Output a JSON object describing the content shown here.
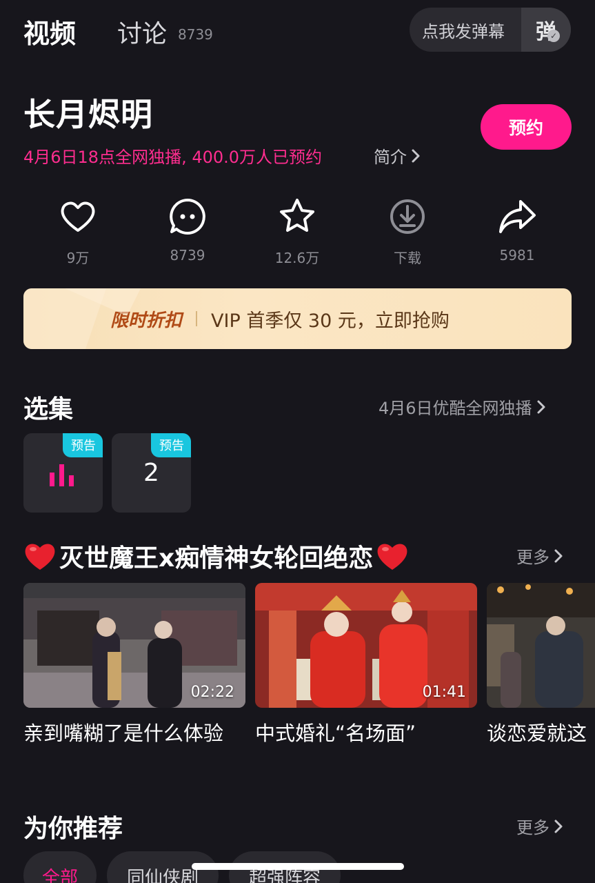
{
  "tabs": {
    "video": "视频",
    "discuss": "讨论",
    "discuss_count": "8739"
  },
  "danmu": {
    "placeholder": "点我发弹幕",
    "toggle_label": "弹"
  },
  "show": {
    "title": "长月烬明",
    "premiere_info": "4月6日18点全网独播, 400.0万人已预约",
    "intro_label": "简介",
    "reserve_label": "预约"
  },
  "actions": [
    {
      "icon": "heart-icon",
      "label": "9万"
    },
    {
      "icon": "comment-icon",
      "label": "8739"
    },
    {
      "icon": "star-icon",
      "label": "12.6万"
    },
    {
      "icon": "download-icon",
      "label": "下载"
    },
    {
      "icon": "share-icon",
      "label": "5981"
    }
  ],
  "vip_banner": {
    "tag": "限时折扣",
    "text": "VIP 首季仅 30 元，立即抢购"
  },
  "episodes": {
    "title": "选集",
    "link": "4月6日优酷全网独播",
    "items": [
      {
        "badge": "预告",
        "label": "",
        "playing": true
      },
      {
        "badge": "预告",
        "label": "2",
        "playing": false
      }
    ]
  },
  "playlist": {
    "title": "灭世魔王x痴情神女轮回绝恋",
    "more_label": "更多",
    "videos": [
      {
        "caption": "亲到嘴糊了是什么体验",
        "duration": "02:22"
      },
      {
        "caption": "中式婚礼“名场面”",
        "duration": "01:41"
      },
      {
        "caption": "谈恋爱就这",
        "duration": ""
      }
    ]
  },
  "recommend": {
    "title": "为你推荐",
    "more_label": "更多",
    "filters": [
      "全部",
      "同仙侠剧",
      "超强阵容"
    ]
  },
  "colors": {
    "background": "#17161c",
    "accent_pink": "#ff1a8c",
    "badge_cyan": "#19c6df",
    "vip_gold": "#f7dfb6"
  }
}
